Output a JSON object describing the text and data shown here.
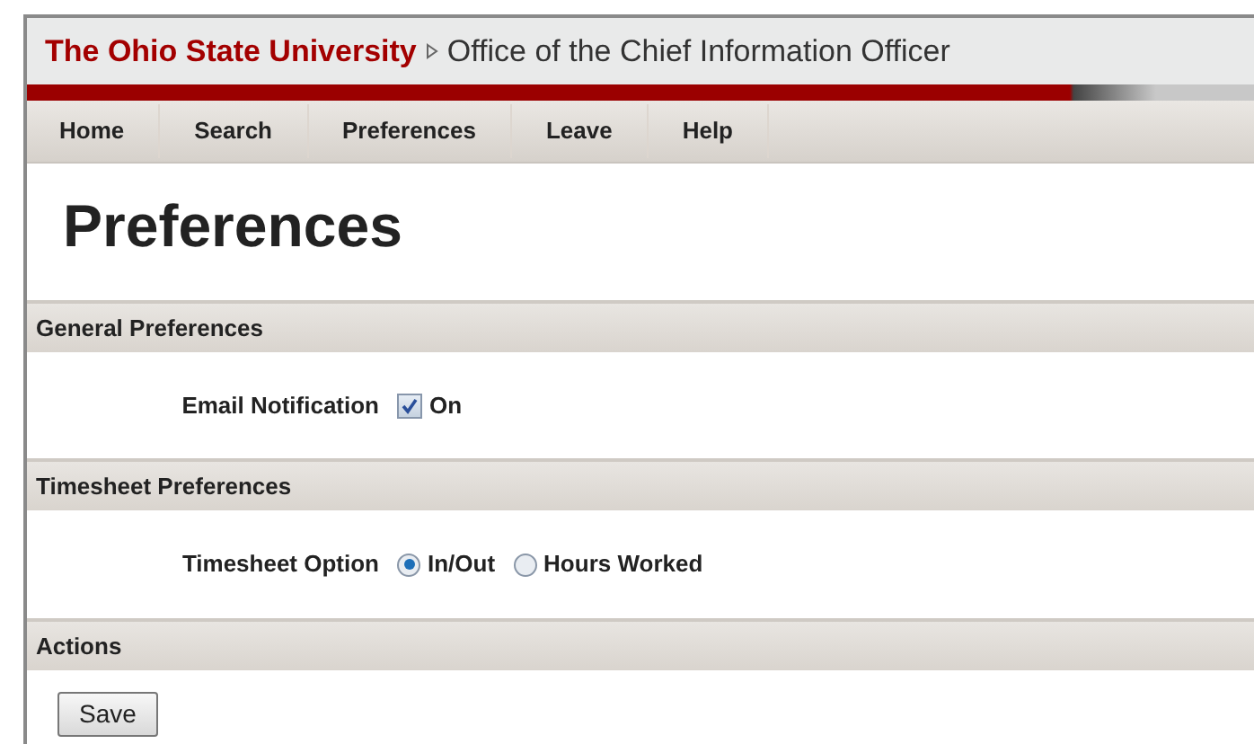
{
  "header": {
    "university": "The Ohio State University",
    "office": "Office of the Chief Information Officer"
  },
  "nav": [
    {
      "label": "Home"
    },
    {
      "label": "Search"
    },
    {
      "label": "Preferences"
    },
    {
      "label": "Leave"
    },
    {
      "label": "Help"
    }
  ],
  "page_title": "Preferences",
  "sections": [
    {
      "title": "General Preferences",
      "kind": "checkbox",
      "label": "Email Notification",
      "options": [
        {
          "label": "On",
          "checked": true
        }
      ]
    },
    {
      "title": "Timesheet Preferences",
      "kind": "radio",
      "label": "Timesheet Option",
      "options": [
        {
          "label": "In/Out",
          "selected": true
        },
        {
          "label": "Hours Worked",
          "selected": false
        }
      ]
    },
    {
      "title": "Actions",
      "kind": "buttons",
      "buttons": [
        "Save"
      ]
    }
  ]
}
